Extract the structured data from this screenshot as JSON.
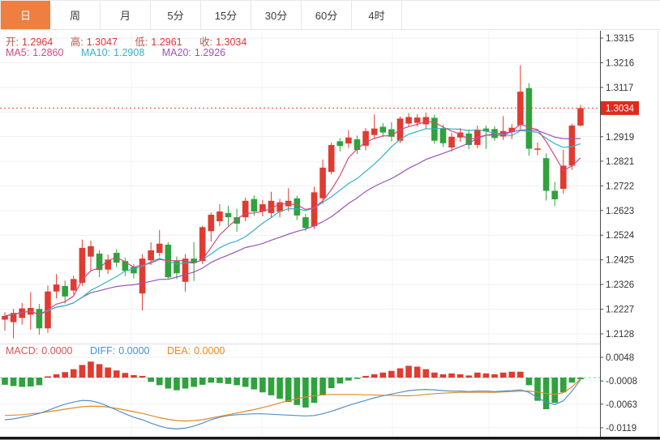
{
  "toolbar": {
    "tabs": [
      {
        "key": "day",
        "label": "日",
        "active": true
      },
      {
        "key": "week",
        "label": "周",
        "active": false
      },
      {
        "key": "month",
        "label": "月",
        "active": false
      },
      {
        "key": "5min",
        "label": "5分",
        "active": false
      },
      {
        "key": "15min",
        "label": "15分",
        "active": false
      },
      {
        "key": "30min",
        "label": "30分",
        "active": false
      },
      {
        "key": "60min",
        "label": "60分",
        "active": false
      },
      {
        "key": "4hour",
        "label": "4时",
        "active": false
      }
    ]
  },
  "overlay": {
    "ohlc": {
      "open_label": "开:",
      "open_value": "1.2964",
      "high_label": "高:",
      "high_value": "1.3047",
      "low_label": "低:",
      "low_value": "1.2961",
      "close_label": "收:",
      "close_value": "1.3034"
    },
    "ma": {
      "ma5_label": "MA5:",
      "ma5_value": "1.2860",
      "ma10_label": "MA10:",
      "ma10_value": "1.2908",
      "ma20_label": "MA20:",
      "ma20_value": "1.2926"
    },
    "macd": {
      "macd_label": "MACD:",
      "macd_value": "0.0000",
      "diff_label": "DIFF:",
      "diff_value": "0.0000",
      "dea_label": "DEA:",
      "dea_value": "0.0000"
    }
  },
  "price_badge": "1.3034",
  "colors": {
    "up": "#e03b30",
    "down": "#2fa23c",
    "ma5": "#d6487e",
    "ma10": "#35b2c0",
    "ma20": "#9a53ba",
    "diff_line": "#5590cc",
    "dea_line": "#e08a28",
    "accent_tab": "#ee7e41",
    "badge": "#e02a1c",
    "price_line": "#ee3b2e",
    "zero_line": "#6ecfc9",
    "grid": "#efefef",
    "axis": "#4a4a4a",
    "tick_text": "#333333"
  },
  "chart_data": {
    "type": "candlestick+macd",
    "title": "",
    "price_axis": {
      "visible_ticks": [
        "1.3315",
        "1.3216",
        "1.3117",
        "1.2919",
        "1.2821",
        "1.2722",
        "1.2623",
        "1.2524",
        "1.2425",
        "1.2326",
        "1.2227",
        "1.2128"
      ],
      "grid_min": 1.2128,
      "grid_max": 1.3315,
      "grid_levels": 13,
      "last_price": 1.3034
    },
    "macd_axis": {
      "visible_ticks": [
        "0.0048",
        "-0.0008",
        "-0.0063",
        "-0.0119"
      ]
    },
    "ma_periods": [
      5,
      10,
      20
    ],
    "candles": [
      [
        1.2185,
        1.2215,
        1.214,
        1.22
      ],
      [
        1.2175,
        1.2228,
        1.211,
        1.2212
      ],
      [
        1.2192,
        1.2252,
        1.2165,
        1.223
      ],
      [
        1.2205,
        1.2295,
        1.2145,
        1.2232
      ],
      [
        1.2228,
        1.2248,
        1.2125,
        1.215
      ],
      [
        1.215,
        1.2322,
        1.2132,
        1.2298
      ],
      [
        1.2298,
        1.2368,
        1.227,
        1.2326
      ],
      [
        1.232,
        1.2342,
        1.225,
        1.2278
      ],
      [
        1.2302,
        1.2362,
        1.2285,
        1.2348
      ],
      [
        1.2333,
        1.2506,
        1.232,
        1.2473
      ],
      [
        1.2438,
        1.2502,
        1.2382,
        1.248
      ],
      [
        1.245,
        1.2464,
        1.2356,
        1.2384
      ],
      [
        1.2386,
        1.2446,
        1.2368,
        1.2426
      ],
      [
        1.2453,
        1.2468,
        1.2396,
        1.2414
      ],
      [
        1.242,
        1.2434,
        1.236,
        1.2381
      ],
      [
        1.2396,
        1.2408,
        1.235,
        1.2371
      ],
      [
        1.229,
        1.2448,
        1.2222,
        1.243
      ],
      [
        1.2423,
        1.2496,
        1.2405,
        1.2463
      ],
      [
        1.2453,
        1.2545,
        1.2438,
        1.249
      ],
      [
        1.2486,
        1.2496,
        1.235,
        1.2355
      ],
      [
        1.242,
        1.2438,
        1.2348,
        1.2371
      ],
      [
        1.2337,
        1.2448,
        1.2298,
        1.243
      ],
      [
        1.243,
        1.2496,
        1.234,
        1.2413
      ],
      [
        1.242,
        1.2562,
        1.2408,
        1.2556
      ],
      [
        1.254,
        1.2615,
        1.2498,
        1.2606
      ],
      [
        1.258,
        1.2648,
        1.256,
        1.2619
      ],
      [
        1.2613,
        1.2642,
        1.2562,
        1.2596
      ],
      [
        1.2596,
        1.263,
        1.2538,
        1.257
      ],
      [
        1.2596,
        1.2675,
        1.258,
        1.2662
      ],
      [
        1.2669,
        1.2684,
        1.2602,
        1.2619
      ],
      [
        1.2619,
        1.2665,
        1.26,
        1.2648
      ],
      [
        1.2613,
        1.2698,
        1.2596,
        1.2662
      ],
      [
        1.2618,
        1.267,
        1.2595,
        1.2656
      ],
      [
        1.264,
        1.2712,
        1.262,
        1.2662
      ],
      [
        1.2672,
        1.2682,
        1.2585,
        1.2603
      ],
      [
        1.2596,
        1.261,
        1.254,
        1.2553
      ],
      [
        1.256,
        1.2718,
        1.2548,
        1.2696
      ],
      [
        1.2672,
        1.2828,
        1.265,
        1.2795
      ],
      [
        1.2778,
        1.2896,
        1.2768,
        1.2886
      ],
      [
        1.2901,
        1.2914,
        1.286,
        1.2882
      ],
      [
        1.2892,
        1.2946,
        1.2874,
        1.2916
      ],
      [
        1.2909,
        1.2924,
        1.285,
        1.2866
      ],
      [
        1.2883,
        1.2954,
        1.2864,
        1.2942
      ],
      [
        1.2926,
        1.3008,
        1.291,
        1.2952
      ],
      [
        1.2959,
        1.2974,
        1.2918,
        1.2936
      ],
      [
        1.2949,
        1.2978,
        1.29,
        1.2919
      ],
      [
        1.2903,
        1.3,
        1.2894,
        1.2992
      ],
      [
        1.2972,
        1.3014,
        1.2958,
        1.2998
      ],
      [
        1.2975,
        1.301,
        1.296,
        1.2996
      ],
      [
        1.2969,
        1.3016,
        1.295,
        1.2998
      ],
      [
        1.2995,
        1.3008,
        1.289,
        1.2903
      ],
      [
        1.2952,
        1.2968,
        1.2878,
        1.2893
      ],
      [
        1.2876,
        1.2934,
        1.286,
        1.2919
      ],
      [
        1.2916,
        1.2954,
        1.2898,
        1.2936
      ],
      [
        1.2932,
        1.2948,
        1.2868,
        1.2886
      ],
      [
        1.2886,
        1.2964,
        1.2873,
        1.2948
      ],
      [
        1.2952,
        1.2964,
        1.287,
        1.294
      ],
      [
        1.295,
        1.2962,
        1.2903,
        1.2914
      ],
      [
        1.292,
        1.3002,
        1.2906,
        1.2942
      ],
      [
        1.2938,
        1.297,
        1.291,
        1.2955
      ],
      [
        1.2965,
        1.3206,
        1.295,
        1.31
      ],
      [
        1.3114,
        1.3134,
        1.2843,
        1.2871
      ],
      [
        1.2868,
        1.2896,
        1.2845,
        1.2872
      ],
      [
        1.2833,
        1.2852,
        1.2663,
        1.2702
      ],
      [
        1.2702,
        1.2738,
        1.2641,
        1.2668
      ],
      [
        1.271,
        1.2866,
        1.269,
        1.2803
      ],
      [
        1.2803,
        1.2972,
        1.2786,
        1.2964
      ],
      [
        1.2964,
        1.3047,
        1.2961,
        1.3034
      ]
    ],
    "macd": {
      "hist": [
        -0.0017,
        -0.002,
        -0.0022,
        -0.0021,
        -0.0018,
        0.0003,
        0.0008,
        0.0013,
        0.002,
        0.003,
        0.0038,
        0.0032,
        0.0024,
        0.0017,
        0.0011,
        0.0006,
        0.0004,
        -0.001,
        -0.0018,
        -0.0026,
        -0.003,
        -0.0026,
        -0.0022,
        -0.0017,
        -0.0012,
        -0.0013,
        -0.0015,
        -0.0018,
        -0.0022,
        -0.0028,
        -0.0035,
        -0.0042,
        -0.005,
        -0.0058,
        -0.0065,
        -0.0071,
        -0.006,
        -0.0042,
        -0.0025,
        -0.0014,
        -0.0007,
        -0.0003,
        0.0004,
        0.0008,
        0.0012,
        0.0016,
        0.0022,
        0.0028,
        0.0026,
        0.002,
        0.0012,
        0.0008,
        0.001,
        0.0008,
        0.0005,
        0.0012,
        0.001,
        0.0008,
        0.0012,
        0.0014,
        0.0014,
        -0.0018,
        -0.0055,
        -0.0075,
        -0.006,
        -0.0035,
        -0.0012,
        -0.0004
      ],
      "diff": [
        -0.01,
        -0.0098,
        -0.0094,
        -0.009,
        -0.0085,
        -0.0078,
        -0.007,
        -0.0063,
        -0.0058,
        -0.0054,
        -0.0055,
        -0.006,
        -0.0068,
        -0.0077,
        -0.0086,
        -0.0094,
        -0.01,
        -0.0108,
        -0.0115,
        -0.012,
        -0.0122,
        -0.012,
        -0.0115,
        -0.0108,
        -0.01,
        -0.0094,
        -0.009,
        -0.0088,
        -0.0087,
        -0.0086,
        -0.0086,
        -0.0087,
        -0.0088,
        -0.0089,
        -0.009,
        -0.0091,
        -0.009,
        -0.0086,
        -0.008,
        -0.0073,
        -0.0066,
        -0.006,
        -0.0054,
        -0.0048,
        -0.0043,
        -0.0039,
        -0.0035,
        -0.0031,
        -0.0029,
        -0.0028,
        -0.0029,
        -0.0031,
        -0.0032,
        -0.0032,
        -0.0033,
        -0.0032,
        -0.0032,
        -0.0033,
        -0.0032,
        -0.0031,
        -0.0029,
        -0.0035,
        -0.0048,
        -0.0058,
        -0.0064,
        -0.0055,
        -0.0032,
        -0.0005
      ],
      "dea": [
        -0.009,
        -0.0089,
        -0.0088,
        -0.0086,
        -0.0084,
        -0.0081,
        -0.0078,
        -0.0075,
        -0.0072,
        -0.0069,
        -0.0068,
        -0.0068,
        -0.007,
        -0.0073,
        -0.0077,
        -0.0081,
        -0.0085,
        -0.009,
        -0.0095,
        -0.0099,
        -0.0102,
        -0.0103,
        -0.0102,
        -0.01,
        -0.0096,
        -0.0092,
        -0.0088,
        -0.0084,
        -0.008,
        -0.0076,
        -0.0071,
        -0.0066,
        -0.006,
        -0.0055,
        -0.005,
        -0.0046,
        -0.0043,
        -0.0041,
        -0.004,
        -0.004,
        -0.004,
        -0.004,
        -0.0041,
        -0.0041,
        -0.0042,
        -0.0042,
        -0.0043,
        -0.0043,
        -0.0042,
        -0.004,
        -0.0038,
        -0.0037,
        -0.0036,
        -0.0035,
        -0.0035,
        -0.0035,
        -0.0035,
        -0.0035,
        -0.0034,
        -0.0033,
        -0.0032,
        -0.0032,
        -0.0034,
        -0.0038,
        -0.004,
        -0.0036,
        -0.0022,
        -0.0003
      ]
    }
  }
}
